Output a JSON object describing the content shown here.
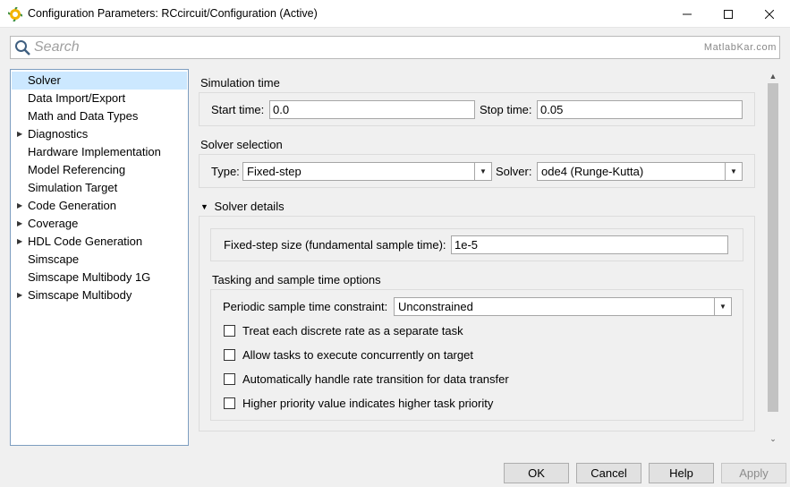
{
  "window": {
    "title": "Configuration Parameters: RCcircuit/Configuration (Active)",
    "app_icon": "simulink-icon",
    "controls": {
      "minimize": "—",
      "maximize": "☐",
      "close": "✕"
    }
  },
  "search": {
    "placeholder": "Search",
    "value": "",
    "watermark": "MatlabKar.com"
  },
  "sidebar": {
    "items": [
      {
        "label": "Solver",
        "selected": true,
        "expandable": false
      },
      {
        "label": "Data Import/Export",
        "expandable": false
      },
      {
        "label": "Math and Data Types",
        "expandable": false
      },
      {
        "label": "Diagnostics",
        "expandable": true
      },
      {
        "label": "Hardware Implementation",
        "expandable": false
      },
      {
        "label": "Model Referencing",
        "expandable": false
      },
      {
        "label": "Simulation Target",
        "expandable": false
      },
      {
        "label": "Code Generation",
        "expandable": true
      },
      {
        "label": "Coverage",
        "expandable": true
      },
      {
        "label": "HDL Code Generation",
        "expandable": true
      },
      {
        "label": "Simscape",
        "expandable": false
      },
      {
        "label": "Simscape Multibody 1G",
        "expandable": false
      },
      {
        "label": "Simscape Multibody",
        "expandable": true
      }
    ]
  },
  "simulation_time": {
    "title": "Simulation time",
    "start_label": "Start time:",
    "start_value": "0.0",
    "stop_label": "Stop time:",
    "stop_value": "0.05"
  },
  "solver_selection": {
    "title": "Solver selection",
    "type_label": "Type:",
    "type_value": "Fixed-step",
    "solver_label": "Solver:",
    "solver_value": "ode4 (Runge-Kutta)"
  },
  "solver_details": {
    "title": "Solver details",
    "expanded": true,
    "step_size_label": "Fixed-step size (fundamental sample time):",
    "step_size_value": "1e-5"
  },
  "tasking": {
    "title": "Tasking and sample time options",
    "periodic_label": "Periodic sample time constraint:",
    "periodic_value": "Unconstrained",
    "checkboxes": [
      {
        "label": "Treat each discrete rate as a separate task",
        "checked": false
      },
      {
        "label": "Allow tasks to execute concurrently on target",
        "checked": false
      },
      {
        "label": "Automatically handle rate transition for data transfer",
        "checked": false
      },
      {
        "label": "Higher priority value indicates higher task priority",
        "checked": false
      }
    ]
  },
  "footer": {
    "ok": "OK",
    "cancel": "Cancel",
    "help": "Help",
    "apply": "Apply"
  },
  "colors": {
    "selected_bg": "#cce8ff",
    "nav_border": "#7d9ec0",
    "window_bg": "#f0f0f0"
  }
}
